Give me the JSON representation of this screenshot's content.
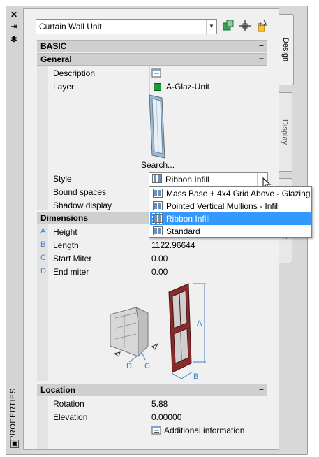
{
  "palette": {
    "title": "PROPERTIES",
    "titlebar_icons": [
      "close-icon",
      "auto-hide-icon",
      "properties-settings-icon"
    ]
  },
  "tabs": {
    "design": "Design",
    "display": "Display",
    "extended": "Ex"
  },
  "object_select": {
    "value": "Curtain Wall Unit"
  },
  "sections": {
    "basic": "BASIC",
    "general": "General",
    "dimensions": "Dimensions",
    "location": "Location",
    "collapse_glyph": "−"
  },
  "general": {
    "description_label": "Description",
    "layer_label": "Layer",
    "layer_value": "A-Glaz-Unit",
    "layer_color": "#1a9a3a",
    "search_label": "Search...",
    "style_label": "Style",
    "style_value": "Ribbon Infill",
    "bound_spaces_label": "Bound spaces",
    "shadow_display_label": "Shadow display"
  },
  "style_dropdown": {
    "options": [
      "Mass Base + 4x4 Grid Above - Glazing",
      "Pointed Vertical Mullions - Infill",
      "Ribbon Infill",
      "Standard"
    ],
    "selected_index": 2
  },
  "dimensions": {
    "height": {
      "letter": "A",
      "label": "Height",
      "value": ""
    },
    "length": {
      "letter": "B",
      "label": "Length",
      "value": "1122.96644"
    },
    "start_miter": {
      "letter": "C",
      "label": "Start Miter",
      "value": "0.00"
    },
    "end_miter": {
      "letter": "D",
      "label": "End miter",
      "value": "0.00"
    },
    "diagram_labels": {
      "a": "A",
      "b": "B",
      "c": "C",
      "d": "D"
    }
  },
  "location": {
    "rotation_label": "Rotation",
    "rotation_value": "5.88",
    "elevation_label": "Elevation",
    "elevation_value": "0.00000",
    "additional_info": "Additional information"
  },
  "colors": {
    "highlight": "#3399ff",
    "dim_letter": "#3f7fbf",
    "frame_red": "#8a2b2b"
  }
}
